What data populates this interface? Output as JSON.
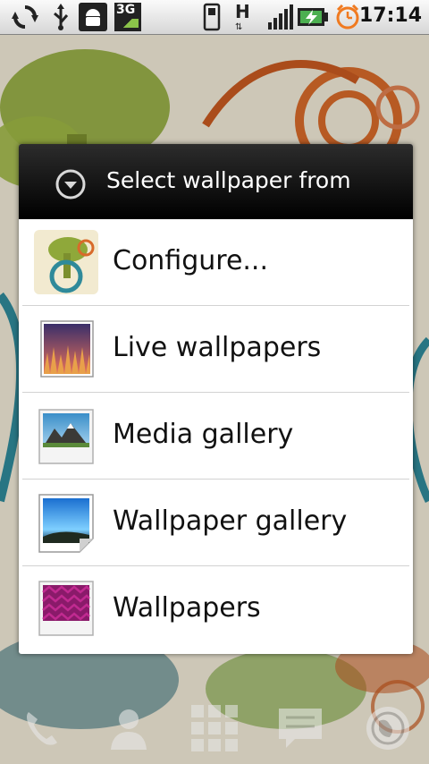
{
  "status_bar": {
    "network_label": "3G",
    "signal_letter": "H",
    "time": "17:14",
    "icons": [
      "sync-icon",
      "usb-icon",
      "android-debug-icon",
      "3g-icon",
      "phone-icon",
      "hspa-icon",
      "signal-icon",
      "battery-charging-icon",
      "alarm-icon"
    ]
  },
  "dialog": {
    "title": "Select wallpaper from",
    "title_icon": "chevron-down-circle-icon",
    "items": [
      {
        "label": "Configure...",
        "icon": "configure-wallpaper-icon"
      },
      {
        "label": "Live wallpapers",
        "icon": "live-wallpapers-icon"
      },
      {
        "label": "Media gallery",
        "icon": "media-gallery-icon"
      },
      {
        "label": "Wallpaper gallery",
        "icon": "wallpaper-gallery-icon"
      },
      {
        "label": "Wallpapers",
        "icon": "wallpapers-icon"
      }
    ]
  },
  "dock": {
    "icons": [
      "phone-icon",
      "contacts-icon",
      "app-drawer-icon",
      "messaging-icon",
      "browser-icon"
    ]
  },
  "colors": {
    "status_bar_bg": "#e6e6e6",
    "dialog_header_bg": "#000000",
    "dialog_bg": "#ffffff",
    "wallpaper_bg": "#f1ead8"
  }
}
